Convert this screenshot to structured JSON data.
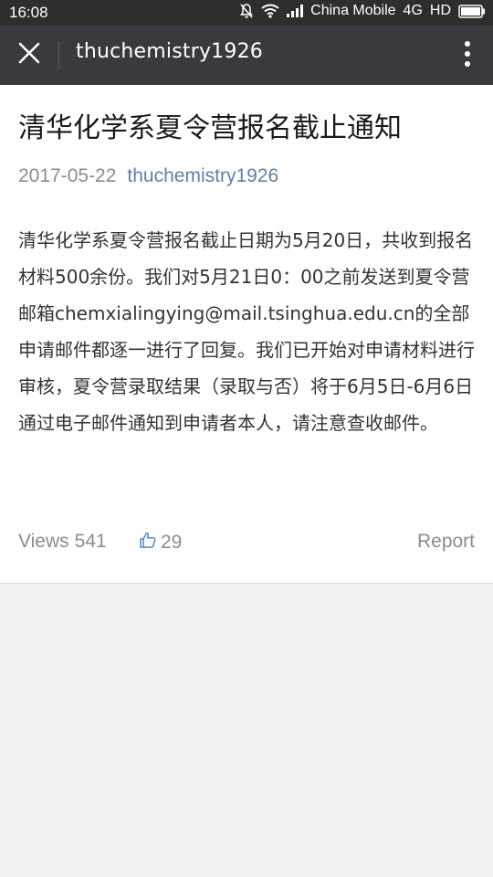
{
  "status_bar": {
    "time": "16:08",
    "carrier": "China Mobile",
    "network": "4G",
    "hd": "HD"
  },
  "app_bar": {
    "title": "thuchemistry1926"
  },
  "article": {
    "title": "清华化学系夏令营报名截止通知",
    "date": "2017-05-22",
    "author": "thuchemistry1926",
    "body": "清华化学系夏令营报名截止日期为5月20日，共收到报名材料500余份。我们对5月21日0：00之前发送到夏令营邮箱chemxialingying@mail.tsinghua.edu.cn的全部申请邮件都逐一进行了回复。我们已开始对申请材料进行审核，夏令营录取结果（录取与否）将于6月5日-6月6日通过电子邮件通知到申请者本人，请注意查收邮件。"
  },
  "footer": {
    "views_label": "Views",
    "views_count": "541",
    "likes_count": "29",
    "report_label": "Report"
  },
  "colors": {
    "status_bar_bg": "#2e2e2e",
    "app_bar_bg": "#393a3f",
    "author_link": "#607fa6",
    "meta_gray": "#8c8c8c",
    "page_bg": "#f1f1f1"
  },
  "icons": {
    "close": "close-icon",
    "more": "more-vertical-icon",
    "like": "thumbs-up-icon",
    "mute": "bell-off-icon",
    "wifi": "wifi-icon",
    "signal": "signal-icon",
    "battery": "battery-icon"
  }
}
